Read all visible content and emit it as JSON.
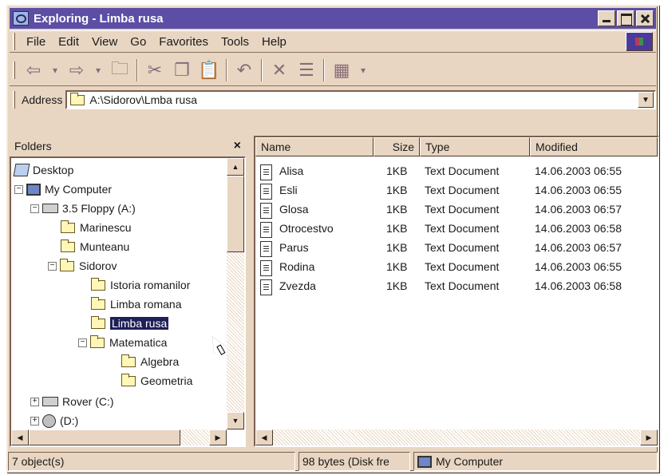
{
  "window": {
    "title": "Exploring - Limba rusa"
  },
  "menu": {
    "items": [
      "File",
      "Edit",
      "View",
      "Go",
      "Favorites",
      "Tools",
      "Help"
    ]
  },
  "toolbar": {
    "buttons": [
      "back-icon",
      "forward-icon",
      "up-folder-icon",
      "cut-icon",
      "copy-icon",
      "paste-icon",
      "undo-icon",
      "delete-icon",
      "properties-icon",
      "views-icon"
    ]
  },
  "address": {
    "label": "Address",
    "value": "A:\\Sidorov\\Lmba rusa"
  },
  "folders": {
    "header": "Folders",
    "tree": [
      {
        "label": "Desktop"
      },
      {
        "label": "My Computer"
      },
      {
        "label": "3.5 Floppy (A:)"
      },
      {
        "label": "Marinescu"
      },
      {
        "label": "Munteanu"
      },
      {
        "label": "Sidorov"
      },
      {
        "label": "Istoria romanilor"
      },
      {
        "label": "Limba romana"
      },
      {
        "label": "Limba rusa"
      },
      {
        "label": "Matematica"
      },
      {
        "label": "Algebra"
      },
      {
        "label": "Geometria"
      },
      {
        "label": "Rover (C:)"
      },
      {
        "label": "(D:)"
      }
    ]
  },
  "files": {
    "columns": [
      "Name",
      "Size",
      "Type",
      "Modified"
    ],
    "rows": [
      {
        "name": "Alisa",
        "size": "1KB",
        "type": "Text Document",
        "modified": "14.06.2003 06:55"
      },
      {
        "name": "Esli",
        "size": "1KB",
        "type": "Text Document",
        "modified": "14.06.2003 06:55"
      },
      {
        "name": "Glosa",
        "size": "1KB",
        "type": "Text Document",
        "modified": "14.06.2003 06:57"
      },
      {
        "name": "Otrocestvo",
        "size": "1KB",
        "type": "Text Document",
        "modified": "14.06.2003 06:58"
      },
      {
        "name": "Parus",
        "size": "1KB",
        "type": "Text Document",
        "modified": "14.06.2003 06:57"
      },
      {
        "name": "Rodina",
        "size": "1KB",
        "type": "Text Document",
        "modified": "14.06.2003 06:55"
      },
      {
        "name": "Zvezda",
        "size": "1KB",
        "type": "Text Document",
        "modified": "14.06.2003 06:58"
      }
    ]
  },
  "status": {
    "objects": "7 object(s)",
    "bytes": "98 bytes (Disk fre",
    "location": "My Computer"
  },
  "colors": {
    "titlebar": "#5b4ea4",
    "face": "#e8d6c2",
    "selection": "#1f1f5a"
  }
}
